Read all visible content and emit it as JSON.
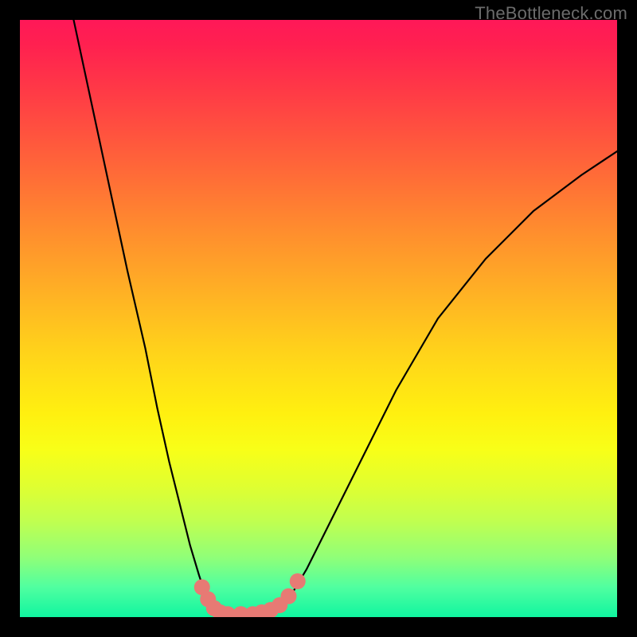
{
  "watermark": "TheBottleneck.com",
  "colors": {
    "background": "#000000",
    "gradient_top": "#ff1858",
    "gradient_bottom": "#10f5a0",
    "curve": "#000000",
    "marker": "#e77a74"
  },
  "chart_data": {
    "type": "line",
    "title": "",
    "xlabel": "",
    "ylabel": "",
    "xlim": [
      0,
      100
    ],
    "ylim": [
      0,
      100
    ],
    "note": "Axes have no visible tick labels in the image; x/y are relative 0–100 estimates. y=0 is the bottom (green) region, y=100 is the top (red).",
    "series": [
      {
        "name": "left-branch",
        "x": [
          9,
          12,
          15,
          18,
          21,
          23,
          25,
          27,
          28.5,
          30,
          31,
          32,
          33
        ],
        "y": [
          100,
          86,
          72,
          58,
          45,
          35,
          26,
          18,
          12,
          7,
          4,
          2,
          0.5
        ]
      },
      {
        "name": "valley-floor",
        "x": [
          33,
          34,
          35,
          36,
          38,
          40,
          42,
          43
        ],
        "y": [
          0.5,
          0.3,
          0.2,
          0.2,
          0.2,
          0.3,
          0.5,
          1
        ]
      },
      {
        "name": "right-branch",
        "x": [
          43,
          45,
          48,
          52,
          57,
          63,
          70,
          78,
          86,
          94,
          100
        ],
        "y": [
          1,
          3,
          8,
          16,
          26,
          38,
          50,
          60,
          68,
          74,
          78
        ]
      }
    ],
    "markers": {
      "name": "highlight-points",
      "x": [
        30.5,
        31.5,
        32.5,
        33.5,
        34.8,
        37,
        39,
        40.5,
        42,
        43.5,
        45,
        46.5
      ],
      "y": [
        5,
        3,
        1.5,
        0.8,
        0.5,
        0.5,
        0.5,
        0.8,
        1.2,
        2,
        3.5,
        6
      ],
      "color": "#e77a74",
      "size": 10
    }
  }
}
